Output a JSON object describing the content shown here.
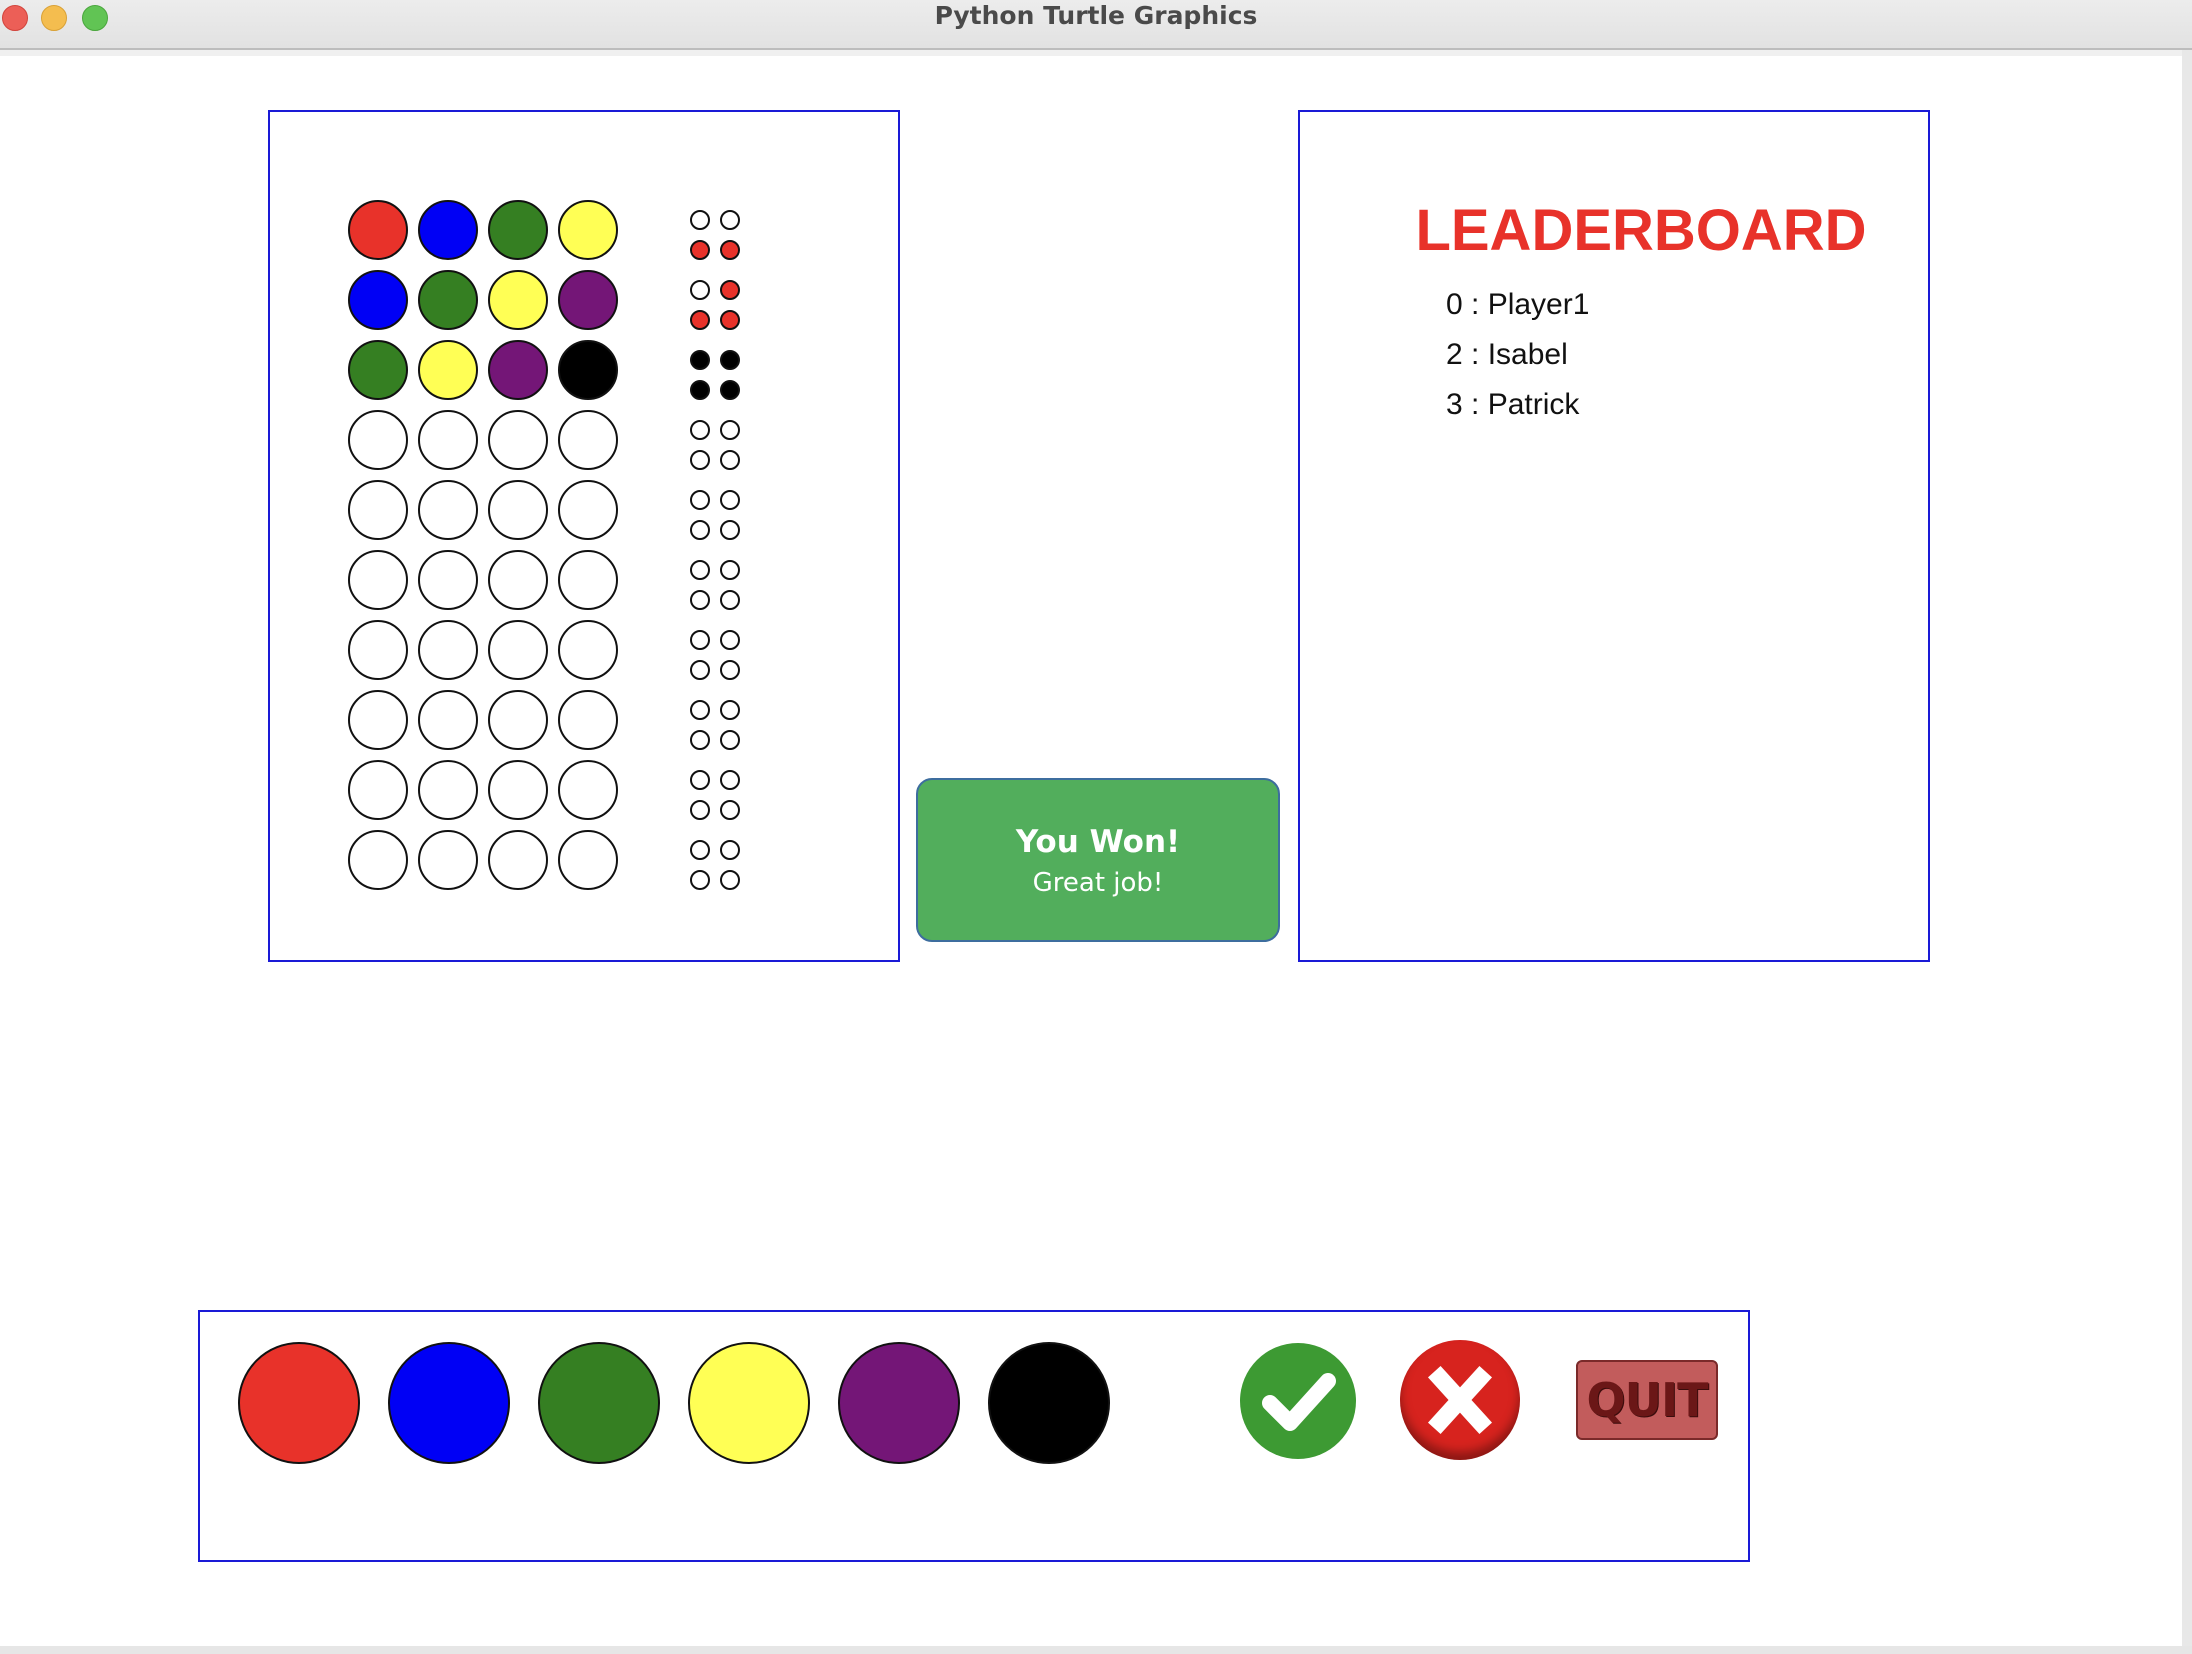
{
  "window": {
    "title": "Python Turtle Graphics"
  },
  "colors": {
    "red": "#e8322a",
    "blue": "#0000f5",
    "green": "#357f22",
    "yellow": "#ffff55",
    "purple": "#741677",
    "black": "#000000",
    "empty": "#ffffff",
    "frame": "#1a1ad6"
  },
  "board": {
    "guesses": [
      [
        "red",
        "blue",
        "green",
        "yellow"
      ],
      [
        "blue",
        "green",
        "yellow",
        "purple"
      ],
      [
        "green",
        "yellow",
        "purple",
        "black"
      ],
      [
        "empty",
        "empty",
        "empty",
        "empty"
      ],
      [
        "empty",
        "empty",
        "empty",
        "empty"
      ],
      [
        "empty",
        "empty",
        "empty",
        "empty"
      ],
      [
        "empty",
        "empty",
        "empty",
        "empty"
      ],
      [
        "empty",
        "empty",
        "empty",
        "empty"
      ],
      [
        "empty",
        "empty",
        "empty",
        "empty"
      ],
      [
        "empty",
        "empty",
        "empty",
        "empty"
      ]
    ],
    "feedback": [
      [
        "empty",
        "empty",
        "red",
        "red"
      ],
      [
        "empty",
        "red",
        "red",
        "red"
      ],
      [
        "black",
        "black",
        "black",
        "black"
      ],
      [
        "empty",
        "empty",
        "empty",
        "empty"
      ],
      [
        "empty",
        "empty",
        "empty",
        "empty"
      ],
      [
        "empty",
        "empty",
        "empty",
        "empty"
      ],
      [
        "empty",
        "empty",
        "empty",
        "empty"
      ],
      [
        "empty",
        "empty",
        "empty",
        "empty"
      ],
      [
        "empty",
        "empty",
        "empty",
        "empty"
      ],
      [
        "empty",
        "empty",
        "empty",
        "empty"
      ]
    ]
  },
  "result": {
    "title": "You Won!",
    "subtitle": "Great job!"
  },
  "leaderboard": {
    "title": "LEADERBOARD",
    "entries": [
      "0 : Player1",
      "2 : Isabel",
      "3 : Patrick"
    ]
  },
  "palette": {
    "colors": [
      "red",
      "blue",
      "green",
      "yellow",
      "purple",
      "black"
    ],
    "check_icon": "checkmark-icon",
    "reset_icon": "x-icon",
    "quit_label": "QUIT"
  }
}
